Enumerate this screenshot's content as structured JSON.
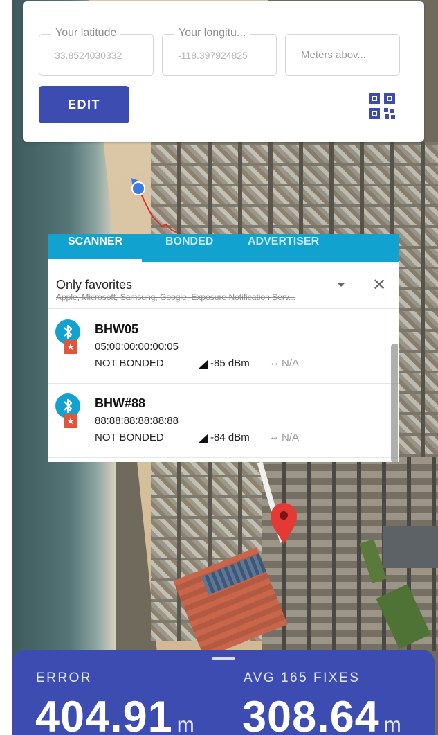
{
  "coords": {
    "latitude_label": "Your latitude",
    "latitude_value": "33.8524030332",
    "longitude_label": "Your longitu...",
    "longitude_value": "-118.397924825",
    "altitude_placeholder": "Meters abov...",
    "edit_label": "EDIT"
  },
  "scanner": {
    "tabs": [
      "SCANNER",
      "BONDED",
      "ADVERTISER"
    ],
    "filter_title": "Only favorites",
    "filter_subtitle": "Apple, Microsoft, Samsung, Google, Exposure Notification Serv...",
    "devices": [
      {
        "name": "BHW05",
        "mac": "05:00:00:00:00:05",
        "bond": "NOT BONDED",
        "rssi": "-85 dBm",
        "interval": "N/A"
      },
      {
        "name": "BHW#88",
        "mac": "88:88:88:88:88:88",
        "bond": "NOT BONDED",
        "rssi": "-84 dBm",
        "interval": "N/A"
      }
    ]
  },
  "stats": {
    "error_label": "ERROR",
    "error_value": "404.91",
    "error_unit": "m",
    "avg_label": "AVG 165 FIXES",
    "avg_value": "308.64",
    "avg_unit": "m"
  },
  "colors": {
    "primary": "#3c4cb0",
    "scanner_accent": "#12a2d0",
    "favorite": "#e0553b",
    "pin": "#e53935"
  }
}
